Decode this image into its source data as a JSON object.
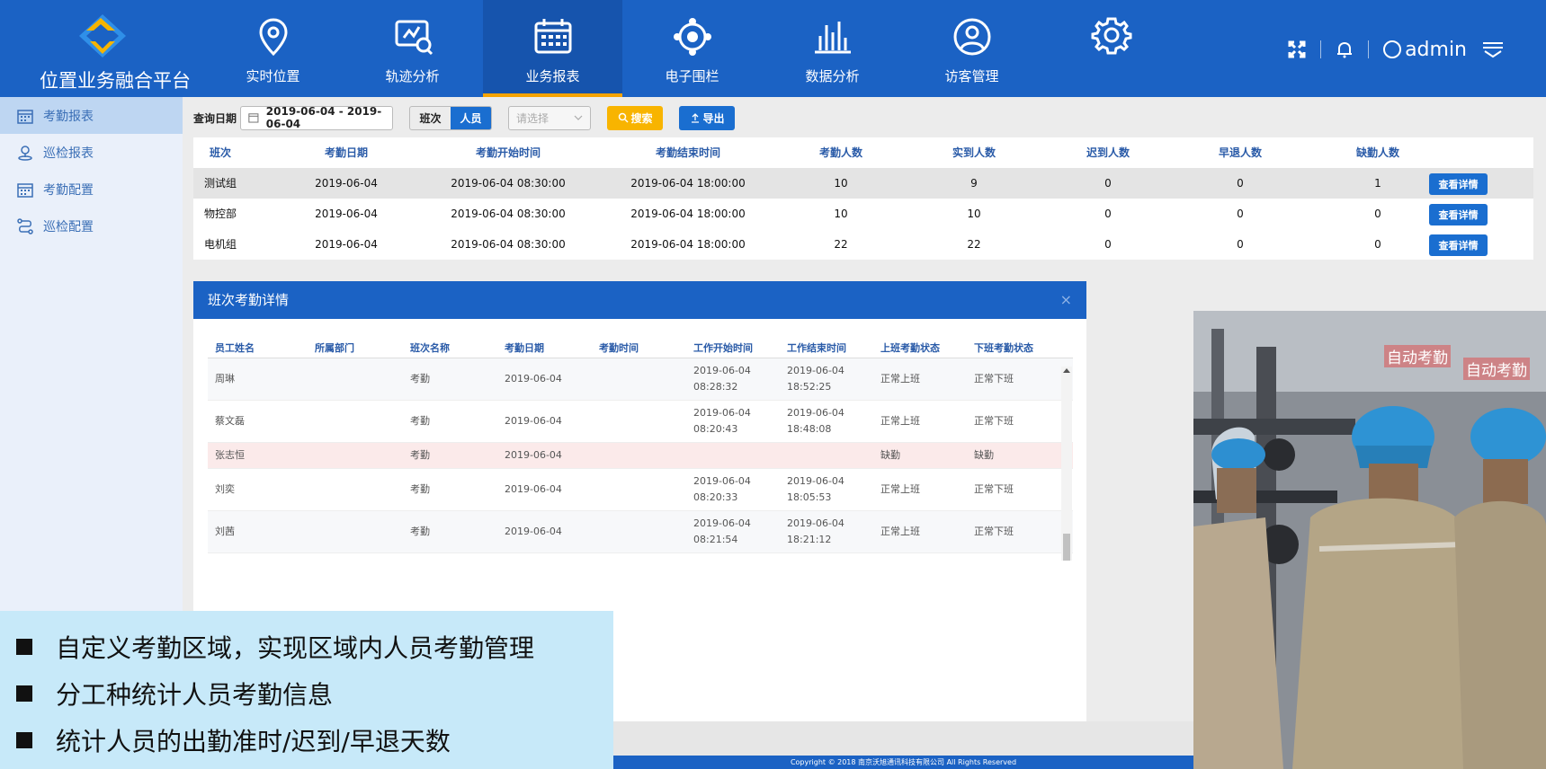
{
  "brand": {
    "title": "位置业务融合平台"
  },
  "nav": [
    {
      "label": "实时位置",
      "icon": "location-pin-icon"
    },
    {
      "label": "轨迹分析",
      "icon": "track-monitor-icon"
    },
    {
      "label": "业务报表",
      "icon": "calendar-icon"
    },
    {
      "label": "电子围栏",
      "icon": "fence-target-icon"
    },
    {
      "label": "数据分析",
      "icon": "bar-chart-icon"
    },
    {
      "label": "访客管理",
      "icon": "user-circle-icon"
    },
    {
      "label": "",
      "icon": "gear-icon"
    }
  ],
  "header": {
    "user": "admin"
  },
  "sidebar": {
    "items": [
      {
        "label": "考勤报表",
        "icon": "calendar-icon"
      },
      {
        "label": "巡检报表",
        "icon": "location-person-icon"
      },
      {
        "label": "考勤配置",
        "icon": "calendar-icon"
      },
      {
        "label": "巡检配置",
        "icon": "route-icon"
      }
    ]
  },
  "toolbar": {
    "date_label": "查询日期",
    "date_range": "2019-06-04 - 2019-06-04",
    "seg_shift": "班次",
    "seg_person": "人员",
    "select_placeholder": "请选择",
    "search_label": "搜索",
    "export_label": "导出"
  },
  "table": {
    "headers": [
      "班次",
      "考勤日期",
      "考勤开始时间",
      "考勤结束时间",
      "考勤人数",
      "实到人数",
      "迟到人数",
      "早退人数",
      "缺勤人数"
    ],
    "detail_label": "查看详情",
    "rows": [
      [
        "测试组",
        "2019-06-04",
        "2019-06-04 08:30:00",
        "2019-06-04 18:00:00",
        "10",
        "9",
        "0",
        "0",
        "1"
      ],
      [
        "物控部",
        "2019-06-04",
        "2019-06-04 08:30:00",
        "2019-06-04 18:00:00",
        "10",
        "10",
        "0",
        "0",
        "0"
      ],
      [
        "电机组",
        "2019-06-04",
        "2019-06-04 08:30:00",
        "2019-06-04 18:00:00",
        "22",
        "22",
        "0",
        "0",
        "0"
      ]
    ]
  },
  "dialog": {
    "title": "班次考勤详情",
    "close": "×",
    "headers": [
      "员工姓名",
      "所属部门",
      "班次名称",
      "考勤日期",
      "考勤时间",
      "工作开始时间",
      "工作结束时间",
      "上班考勤状态",
      "下班考勤状态"
    ],
    "rows": [
      [
        "周琳",
        "",
        "考勤",
        "2019-06-04",
        "",
        "2019-06-04 08:28:32",
        "2019-06-04 18:52:25",
        "正常上班",
        "正常下班"
      ],
      [
        "蔡文磊",
        "",
        "考勤",
        "2019-06-04",
        "",
        "2019-06-04 08:20:43",
        "2019-06-04 18:48:08",
        "正常上班",
        "正常下班"
      ],
      [
        "张志恒",
        "",
        "考勤",
        "2019-06-04",
        "",
        "",
        "",
        "缺勤",
        "缺勤"
      ],
      [
        "刘奕",
        "",
        "考勤",
        "2019-06-04",
        "",
        "2019-06-04 08:20:33",
        "2019-06-04 18:05:53",
        "正常上班",
        "正常下班"
      ],
      [
        "刘茜",
        "",
        "考勤",
        "2019-06-04",
        "",
        "2019-06-04 08:21:54",
        "2019-06-04 18:21:12",
        "正常上班",
        "正常下班"
      ]
    ]
  },
  "features": [
    "自定义考勤区域，实现区域内人员考勤管理",
    "分工种统计人员考勤信息",
    "统计人员的出勤准时/迟到/早退天数"
  ],
  "footer": {
    "text": "Copyright © 2018   南京沃旭通讯科技有限公司 All Rights Reserved"
  },
  "photo": {
    "tags": [
      "自动考勤",
      "自动考勤"
    ]
  }
}
